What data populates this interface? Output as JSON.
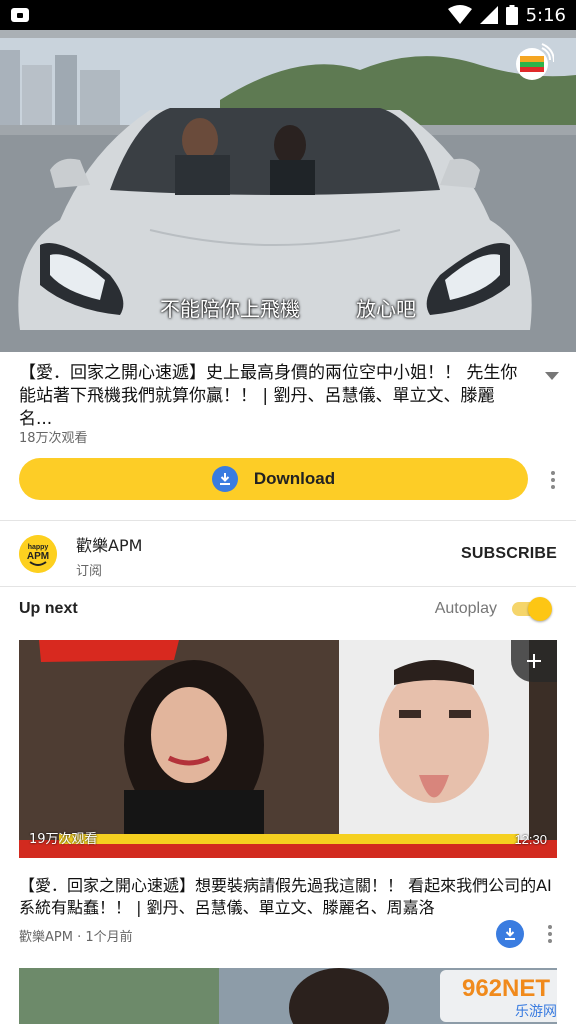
{
  "status_bar": {
    "time": "5:16"
  },
  "player": {
    "subtitle_left": "不能陪你上飛機",
    "subtitle_right": "放心吧",
    "channel_logo": "tvb-logo"
  },
  "video": {
    "title": "【愛．回家之開心速遞】史上最高身價的兩位空中小姐！！ 先生你能站著下飛機我們就算你贏！！ | 劉丹、呂慧儀、單立文、滕麗名...",
    "views": "18万次观看",
    "download_label": "Download"
  },
  "channel": {
    "avatar_text_top": "happy",
    "avatar_text_bottom": "APM",
    "name": "歡樂APM",
    "subscribed_label": "订阅",
    "subscribe_button": "SUBSCRIBE"
  },
  "up_next": {
    "label": "Up next",
    "autoplay_label": "Autoplay",
    "autoplay_on": true
  },
  "next_video": {
    "thumb_views": "19万次观看",
    "duration": "12:30",
    "title": "【愛．回家之開心速遞】想要裝病請假先過我這關！！ 看起來我們公司的AI系統有點蠢！！ | 劉丹、呂慧儀、單立文、滕麗名、周嘉洛",
    "meta": "歡樂APM · 1个月前"
  },
  "watermark": {
    "text_main": "962NET",
    "text_sub": "乐游网"
  },
  "colors": {
    "accent_yellow": "#fdcd26",
    "download_blue": "#3a7ce0",
    "status_bar": "#000000"
  }
}
